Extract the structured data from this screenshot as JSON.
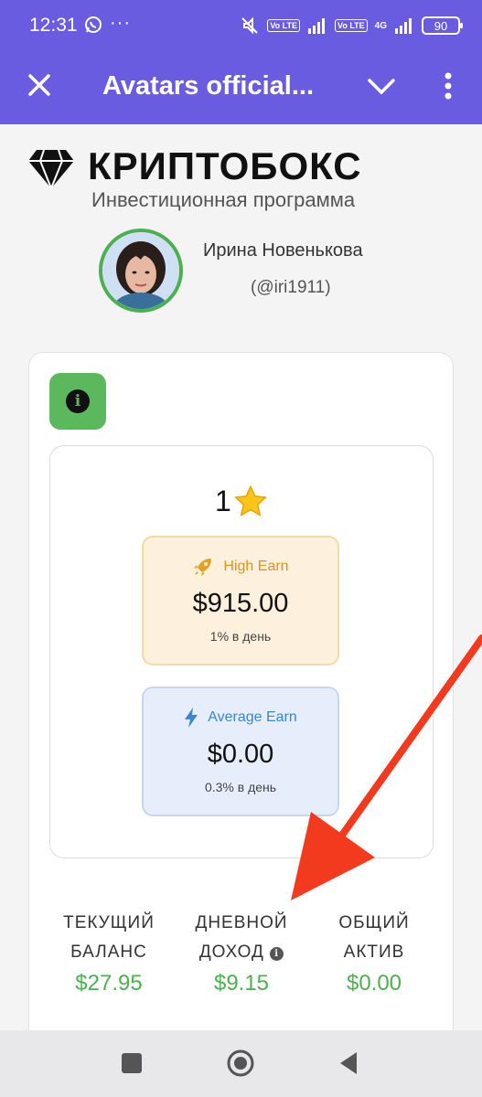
{
  "status_bar": {
    "time": "12:31",
    "network": "4G",
    "volte1": "Vo LTE",
    "volte2": "Vo LTE",
    "battery": "90",
    "more": "···"
  },
  "app_bar": {
    "title": "Avatars official...",
    "color": "#6a5ce0"
  },
  "brand": {
    "name": "КРИПТОБОКС",
    "subtitle": "Инвестиционная программа"
  },
  "profile": {
    "name": "Ирина Новенькова",
    "handle": "(@iri1911)"
  },
  "level": {
    "value": "1"
  },
  "plans": [
    {
      "name": "High Earn",
      "amount": "$915.00",
      "rate": "1% в день",
      "accent": "#d99522"
    },
    {
      "name": "Average Earn",
      "amount": "$0.00",
      "rate": "0.3% в день",
      "accent": "#3a86d0"
    }
  ],
  "stats": [
    {
      "label_line1": "ТЕКУЩИЙ",
      "label_line2": "БАЛАНС",
      "value": "$27.95"
    },
    {
      "label_line1": "ДНЕВНОЙ",
      "label_line2": "ДОХОД",
      "value": "$9.15"
    },
    {
      "label_line1": "ОБЩИЙ",
      "label_line2": "АКТИВ",
      "value": "$0.00"
    }
  ],
  "colors": {
    "positive": "#4caf50",
    "annotation_arrow": "#f23a1f"
  }
}
